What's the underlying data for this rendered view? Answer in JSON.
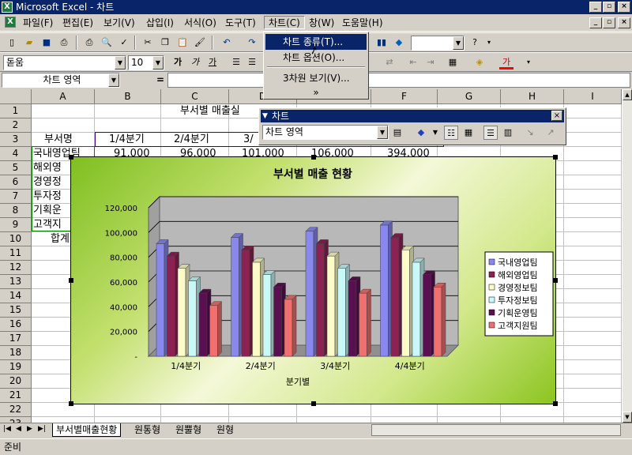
{
  "window": {
    "title": "Microsoft Excel - 차트",
    "app_icon": "excel-icon"
  },
  "menubar": {
    "items": [
      "파일(F)",
      "편집(E)",
      "보기(V)",
      "삽입(I)",
      "서식(O)",
      "도구(T)",
      "차트(C)",
      "창(W)",
      "도움말(H)"
    ],
    "active": "차트(C)"
  },
  "chart_menu": {
    "items": [
      "차트 종류(T)...",
      "차트 옵션(O)...",
      "3차원 보기(V)..."
    ],
    "more": "»"
  },
  "format_bar": {
    "font": "돋움",
    "size": "10",
    "bold": "가",
    "italic": "가",
    "underline": "가",
    "font_color_label": "가"
  },
  "formula_bar": {
    "name_box": "차트 영역",
    "equals": "="
  },
  "columns": [
    "A",
    "B",
    "C",
    "D",
    "E",
    "F",
    "G",
    "H",
    "I"
  ],
  "rows": [
    "1",
    "2",
    "3",
    "4",
    "5",
    "6",
    "7",
    "8",
    "9",
    "10",
    "11",
    "12",
    "13",
    "14",
    "15",
    "16",
    "17",
    "18",
    "19",
    "20",
    "21",
    "22",
    "23"
  ],
  "sheet": {
    "title_cell": "부서별 매출실",
    "header": [
      "부서명",
      "1/4분기",
      "2/4분기",
      "3/"
    ],
    "row4": [
      "국내영업팀",
      "91,000",
      "96,000",
      "101,000",
      "106,000",
      "394,000"
    ],
    "col_a": [
      "해외영",
      "경영정",
      "투자정",
      "기획운",
      "고객지"
    ],
    "total_label": "합계"
  },
  "chart_toolbar": {
    "title": "차트",
    "object_combo": "차트 영역"
  },
  "sheet_tabs": {
    "tabs": [
      "부서별매출현황",
      "원통형",
      "원뿔형",
      "원형"
    ],
    "active": "부서별매출현황"
  },
  "status": {
    "text": "준비"
  },
  "chart_data": {
    "type": "bar",
    "title": "부서별 매출 현황",
    "xlabel": "분기별",
    "ylabel": "",
    "categories": [
      "1/4분기",
      "2/4분기",
      "3/4분기",
      "4/4분기"
    ],
    "ylim": [
      0,
      120000
    ],
    "yticks": [
      "-",
      "20,000",
      "40,000",
      "60,000",
      "80,000",
      "100,000",
      "120,000"
    ],
    "series": [
      {
        "name": "국내영업팀",
        "values": [
          91000,
          96000,
          101000,
          106000
        ],
        "color": "#8888ee"
      },
      {
        "name": "해외영업팀",
        "values": [
          81000,
          86000,
          91000,
          96000
        ],
        "color": "#8b2252"
      },
      {
        "name": "경영정보팀",
        "values": [
          71000,
          76000,
          81000,
          86000
        ],
        "color": "#fdfbc8"
      },
      {
        "name": "투자정보팀",
        "values": [
          61000,
          66000,
          71000,
          76000
        ],
        "color": "#c8f8f8"
      },
      {
        "name": "기획운영팀",
        "values": [
          51000,
          56000,
          61000,
          66000
        ],
        "color": "#5a1050"
      },
      {
        "name": "고객지원팀",
        "values": [
          41000,
          46000,
          51000,
          56000
        ],
        "color": "#f07070"
      }
    ],
    "legend": "right",
    "grid": true
  }
}
